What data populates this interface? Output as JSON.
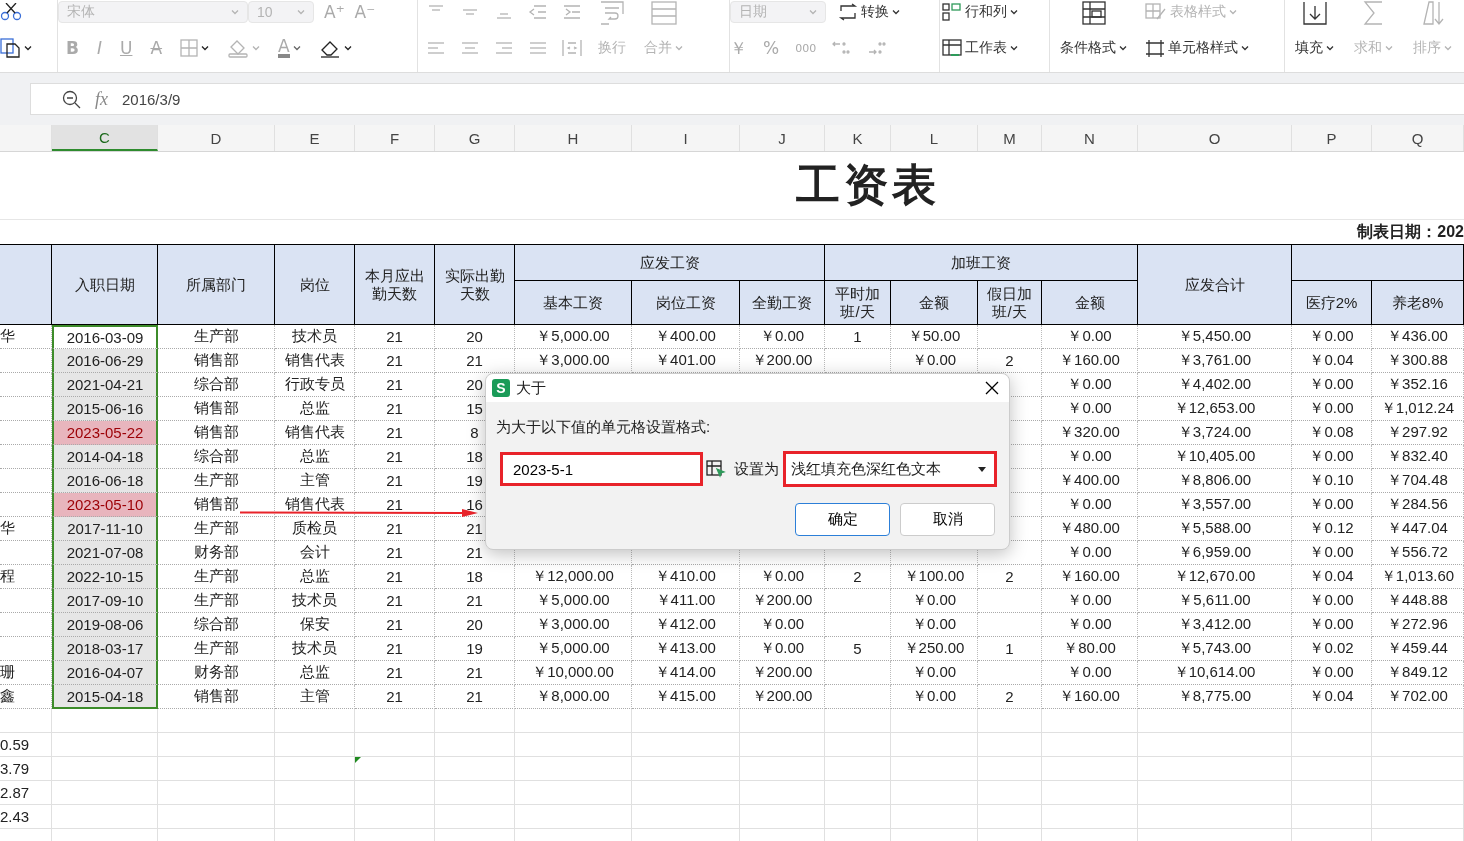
{
  "toolbar": {
    "font": {
      "name": {
        "value": "宋体",
        "disabled": true
      },
      "size": {
        "value": "10",
        "disabled": true
      },
      "grow": "A⁺",
      "shrink": "A⁻",
      "styles": [
        "B",
        "I",
        "U",
        "A"
      ],
      "font_color": "A"
    },
    "alignment": {
      "wrap": {
        "label": "换行",
        "disabled": true
      },
      "merge": {
        "label": "合并",
        "disabled": true
      }
    },
    "number": {
      "format": {
        "value": "日期",
        "disabled": true
      },
      "convert": {
        "label": "转换",
        "disabled": false
      },
      "currency": "￥",
      "percent": "%",
      "thousands": "000"
    },
    "cells": [
      {
        "label": "行和列",
        "disabled": false
      },
      {
        "label": "工作表",
        "disabled": false
      }
    ],
    "styles": [
      {
        "label": "条件格式",
        "disabled": false
      },
      {
        "label": "表格样式",
        "disabled": true
      },
      {
        "label": "单元格样式",
        "disabled": false
      }
    ],
    "editing": [
      {
        "label": "填充",
        "disabled": false
      },
      {
        "label": "求和",
        "disabled": true
      },
      {
        "label": "排序",
        "disabled": true
      }
    ]
  },
  "formula_bar": {
    "fx": "fx",
    "value": "2016/3/9"
  },
  "columns": [
    {
      "letter": "C",
      "selected": true
    },
    {
      "letter": "D",
      "selected": false
    },
    {
      "letter": "E",
      "selected": false
    },
    {
      "letter": "F",
      "selected": false
    },
    {
      "letter": "G",
      "selected": false
    },
    {
      "letter": "H",
      "selected": false
    },
    {
      "letter": "I",
      "selected": false
    },
    {
      "letter": "J",
      "selected": false
    },
    {
      "letter": "K",
      "selected": false
    },
    {
      "letter": "L",
      "selected": false
    },
    {
      "letter": "M",
      "selected": false
    },
    {
      "letter": "N",
      "selected": false
    },
    {
      "letter": "O",
      "selected": false
    },
    {
      "letter": "P",
      "selected": false
    },
    {
      "letter": "Q",
      "selected": false
    }
  ],
  "sheet": {
    "title": "工资表",
    "date_label": "制表日期：202",
    "headers": [
      {
        "label": "入职日期"
      },
      {
        "label": "所属部门"
      },
      {
        "label": "岗位"
      },
      {
        "label": "本月应出勤天数"
      },
      {
        "label": "实际出勤天数"
      },
      {
        "label": "应发工资",
        "children": [
          {
            "label": "基本工资"
          },
          {
            "label": "岗位工资"
          },
          {
            "label": "全勤工资"
          }
        ]
      },
      {
        "label": "加班工资",
        "children": [
          {
            "label": "平时加班/天"
          },
          {
            "label": "金额"
          },
          {
            "label": "假日加班/天"
          },
          {
            "label": "金额"
          }
        ]
      },
      {
        "label": "应发合计"
      },
      {
        "children": [
          {
            "label": "医疗2%"
          },
          {
            "label": "养老8%"
          }
        ]
      }
    ],
    "rows": [
      {
        "active": true,
        "date_highlighted": false,
        "cells": [
          "华",
          "2016-03-09",
          "生产部",
          "技术员",
          "21",
          "20",
          "￥5,000.00",
          "￥400.00",
          "￥0.00",
          "1",
          "￥50.00",
          null,
          "￥0.00",
          "￥5,450.00",
          "￥0.00",
          "￥436.00"
        ]
      },
      {
        "active": false,
        "date_highlighted": false,
        "cells": [
          null,
          "2016-06-29",
          "销售部",
          "销售代表",
          "21",
          "21",
          "￥3,000.00",
          "￥401.00",
          "￥200.00",
          null,
          "￥0.00",
          "2",
          "￥160.00",
          "￥3,761.00",
          "￥0.04",
          "￥300.88"
        ]
      },
      {
        "active": false,
        "date_highlighted": false,
        "cells": [
          null,
          "2021-04-21",
          "综合部",
          "行政专员",
          "21",
          "20",
          null,
          null,
          null,
          null,
          null,
          null,
          "￥0.00",
          "￥4,402.00",
          "￥0.00",
          "￥352.16"
        ]
      },
      {
        "active": false,
        "date_highlighted": false,
        "cells": [
          null,
          "2015-06-16",
          "销售部",
          "总监",
          "21",
          "15",
          null,
          null,
          null,
          null,
          null,
          null,
          "￥0.00",
          "￥12,653.00",
          "￥0.00",
          "￥1,012.24"
        ]
      },
      {
        "active": false,
        "date_highlighted": true,
        "cells": [
          null,
          "2023-05-22",
          "销售部",
          "销售代表",
          "21",
          "8",
          null,
          null,
          null,
          null,
          null,
          null,
          "￥320.00",
          "￥3,724.00",
          "￥0.08",
          "￥297.92"
        ]
      },
      {
        "active": false,
        "date_highlighted": false,
        "cells": [
          null,
          "2014-04-18",
          "综合部",
          "总监",
          "21",
          "18",
          null,
          null,
          null,
          null,
          null,
          null,
          "￥0.00",
          "￥10,405.00",
          "￥0.00",
          "￥832.40"
        ]
      },
      {
        "active": false,
        "date_highlighted": false,
        "cells": [
          null,
          "2016-06-18",
          "生产部",
          "主管",
          "21",
          "19",
          null,
          null,
          null,
          null,
          null,
          null,
          "￥400.00",
          "￥8,806.00",
          "￥0.10",
          "￥704.48"
        ]
      },
      {
        "active": false,
        "date_highlighted": true,
        "cells": [
          null,
          "2023-05-10",
          "销售部",
          "销售代表",
          "21",
          "16",
          null,
          null,
          null,
          null,
          null,
          null,
          "￥0.00",
          "￥3,557.00",
          "￥0.00",
          "￥284.56"
        ]
      },
      {
        "active": false,
        "date_highlighted": false,
        "cells": [
          "华",
          "2017-11-10",
          "生产部",
          "质检员",
          "21",
          "21",
          null,
          null,
          null,
          null,
          null,
          null,
          "￥480.00",
          "￥5,588.00",
          "￥0.12",
          "￥447.04"
        ]
      },
      {
        "active": false,
        "date_highlighted": false,
        "cells": [
          null,
          "2021-07-08",
          "财务部",
          "会计",
          "21",
          "21",
          null,
          null,
          null,
          null,
          null,
          null,
          "￥0.00",
          "￥6,959.00",
          "￥0.00",
          "￥556.72"
        ]
      },
      {
        "active": false,
        "date_highlighted": false,
        "cells": [
          "程",
          "2022-10-15",
          "生产部",
          "总监",
          "21",
          "18",
          "￥12,000.00",
          "￥410.00",
          "￥0.00",
          "2",
          "￥100.00",
          "2",
          "￥160.00",
          "￥12,670.00",
          "￥0.04",
          "￥1,013.60"
        ]
      },
      {
        "active": false,
        "date_highlighted": false,
        "cells": [
          null,
          "2017-09-10",
          "生产部",
          "技术员",
          "21",
          "21",
          "￥5,000.00",
          "￥411.00",
          "￥200.00",
          null,
          "￥0.00",
          null,
          "￥0.00",
          "￥5,611.00",
          "￥0.00",
          "￥448.88"
        ]
      },
      {
        "active": false,
        "date_highlighted": false,
        "cells": [
          null,
          "2019-08-06",
          "综合部",
          "保安",
          "21",
          "20",
          "￥3,000.00",
          "￥412.00",
          "￥0.00",
          null,
          "￥0.00",
          null,
          "￥0.00",
          "￥3,412.00",
          "￥0.00",
          "￥272.96"
        ]
      },
      {
        "active": false,
        "date_highlighted": false,
        "cells": [
          null,
          "2018-03-17",
          "生产部",
          "技术员",
          "21",
          "19",
          "￥5,000.00",
          "￥413.00",
          "￥0.00",
          "5",
          "￥250.00",
          "1",
          "￥80.00",
          "￥5,743.00",
          "￥0.02",
          "￥459.44"
        ]
      },
      {
        "active": false,
        "date_highlighted": false,
        "cells": [
          "珊",
          "2016-04-07",
          "财务部",
          "总监",
          "21",
          "21",
          "￥10,000.00",
          "￥414.00",
          "￥200.00",
          null,
          "￥0.00",
          null,
          "￥0.00",
          "￥10,614.00",
          "￥0.00",
          "￥849.12"
        ]
      },
      {
        "active": false,
        "date_highlighted": false,
        "cells": [
          "鑫",
          "2015-04-18",
          "销售部",
          "主管",
          "21",
          "21",
          "￥8,000.00",
          "￥415.00",
          "￥200.00",
          null,
          "￥0.00",
          "2",
          "￥160.00",
          "￥8,775.00",
          "￥0.04",
          "￥702.00"
        ]
      }
    ],
    "below": [
      {
        "value": "0.59",
        "g_error": false
      },
      {
        "value": "3.79",
        "g_error": true
      },
      {
        "value": "2.87",
        "g_error": false
      },
      {
        "value": "2.43",
        "g_error": false
      }
    ]
  },
  "dialog": {
    "badge": "S",
    "title": "大于",
    "prompt": "为大于以下值的单元格设置格式:",
    "value": "2023-5-1",
    "value_highlighted": true,
    "set_label": "设置为",
    "format": "浅红填充色深红色文本",
    "format_highlighted": true,
    "buttons": [
      {
        "label": "确定",
        "primary": true
      },
      {
        "label": "取消",
        "primary": false
      }
    ]
  }
}
